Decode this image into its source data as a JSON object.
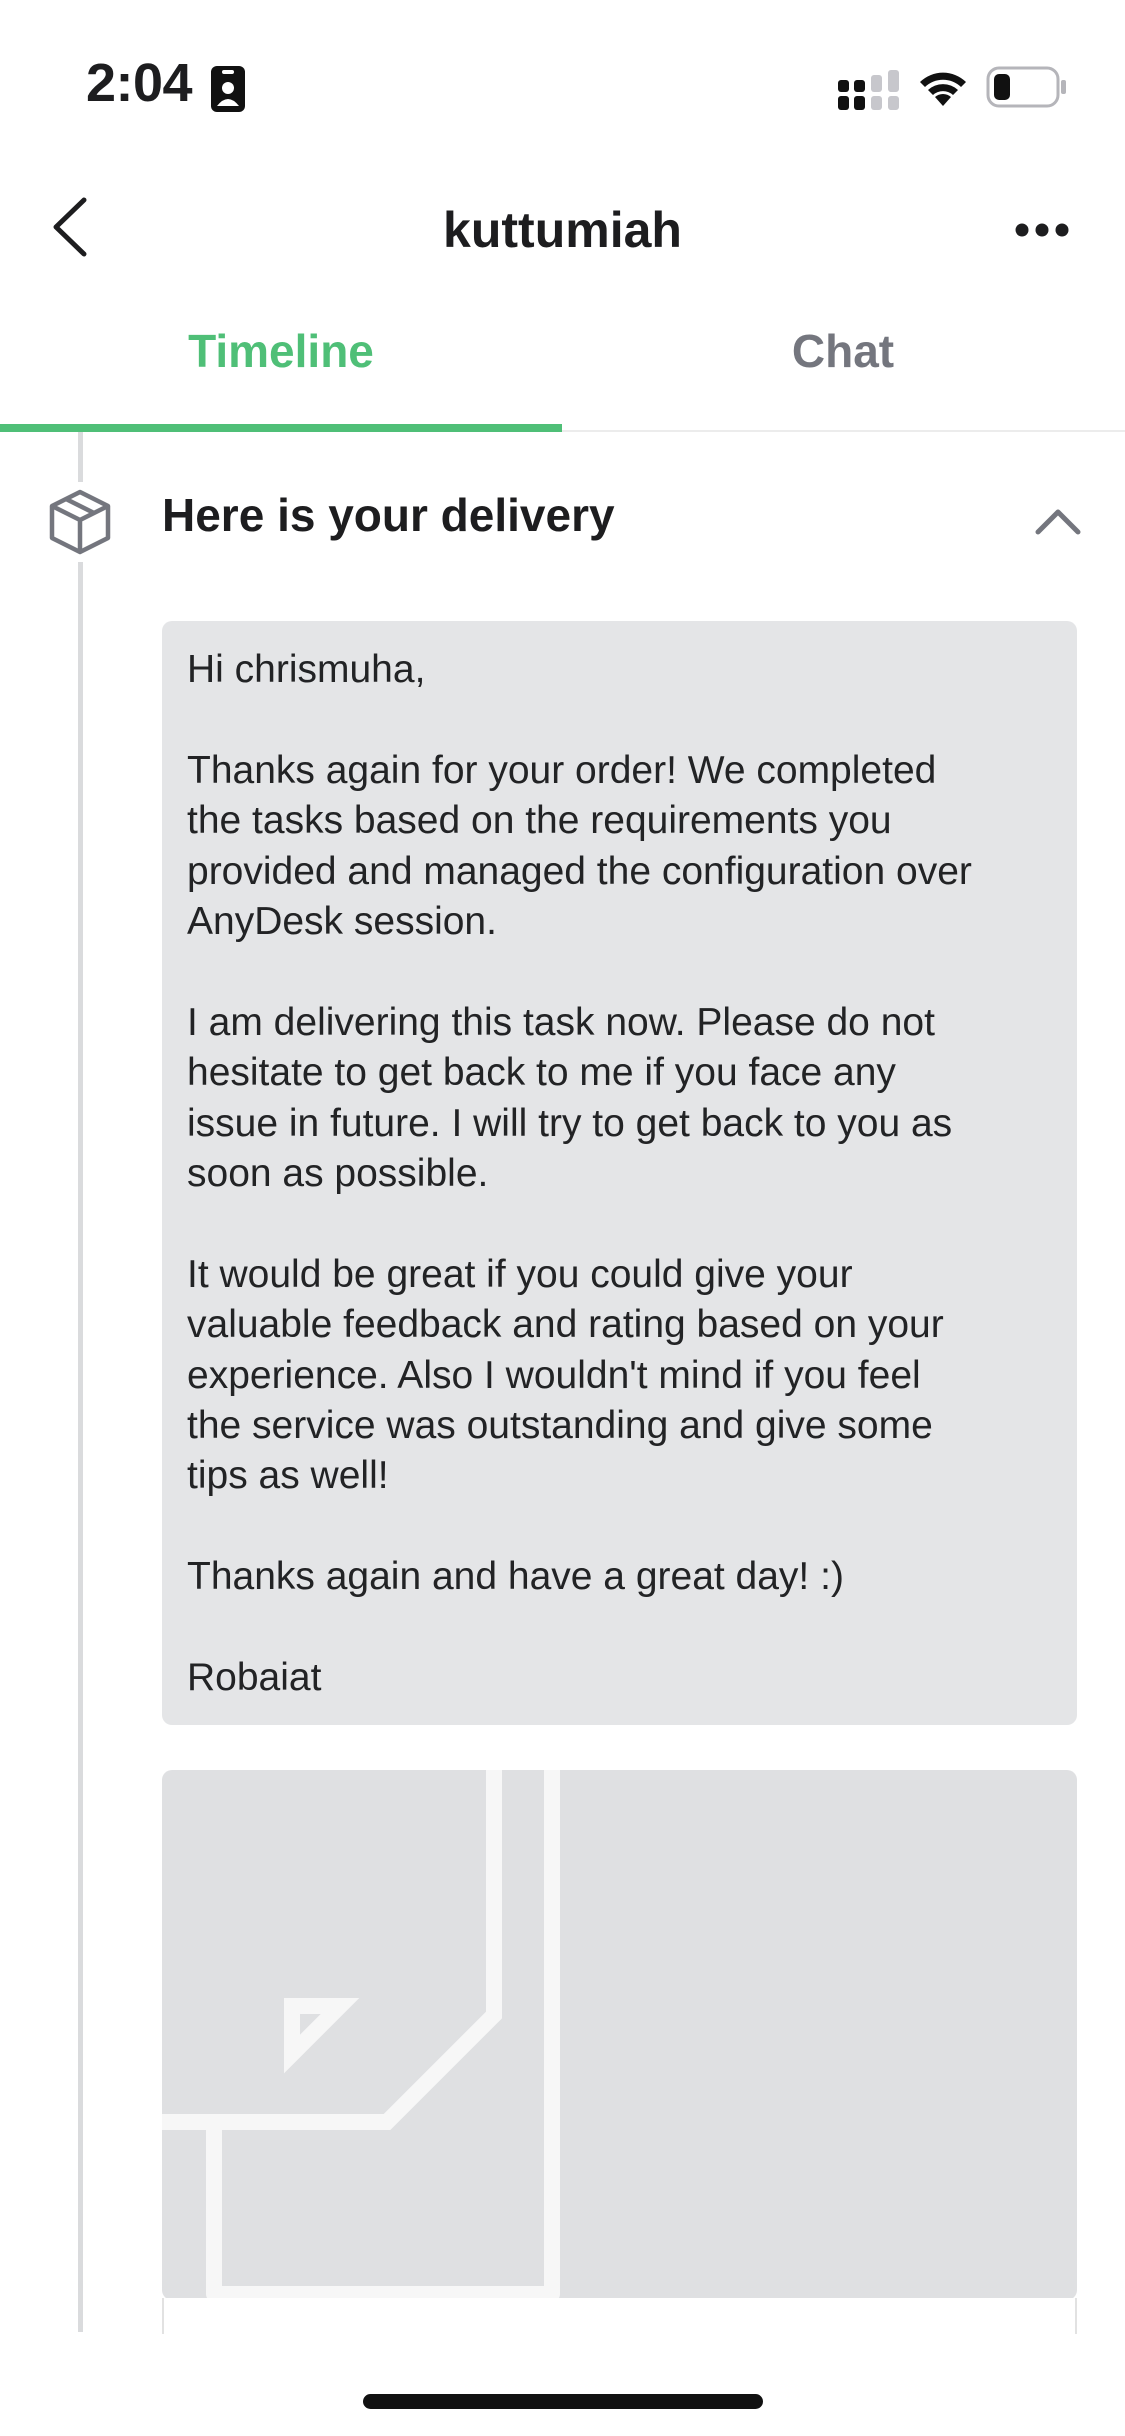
{
  "status_bar": {
    "time": "2:04"
  },
  "nav": {
    "title": "kuttumiah"
  },
  "tabs": [
    {
      "label": "Timeline",
      "active": true
    },
    {
      "label": "Chat",
      "active": false
    }
  ],
  "colors": {
    "accent": "#4fbf77",
    "inactive_tab": "#74767e",
    "message_bg": "#e4e5e7"
  },
  "event": {
    "title": "Here is your delivery",
    "icon": "package-box-icon",
    "message_lines": [
      "Hi chrismuha,",
      "",
      "Thanks again for your order! We completed",
      "the tasks based on the requirements you",
      "provided and managed the configuration over",
      "AnyDesk session.",
      "",
      "I am delivering this task now. Please do not",
      "hesitate to get back to me if you face any",
      "issue in future. I will try to get back to you as",
      "soon as possible.",
      "",
      "It would be great if you could give your",
      "valuable feedback and rating based on your",
      "experience. Also I wouldn't mind if you feel",
      "the service was outstanding and give some",
      "tips as well!",
      "",
      "Thanks again and have a great day! :)",
      "",
      "Robaiat"
    ]
  },
  "attachment": {
    "icon": "file-placeholder-icon"
  }
}
